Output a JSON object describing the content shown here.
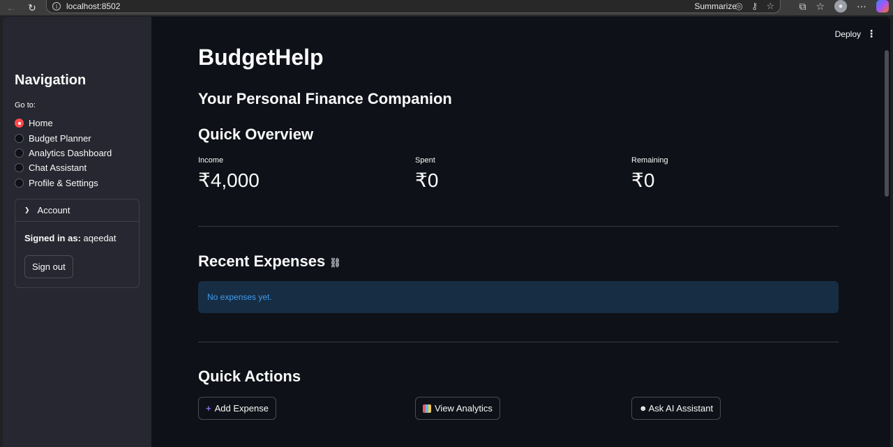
{
  "browser": {
    "url": "localhost:8502",
    "summarize_label": "Summarize"
  },
  "sidebar": {
    "title": "Navigation",
    "goto_label": "Go to:",
    "items": [
      {
        "label": "Home",
        "checked": true
      },
      {
        "label": "Budget Planner",
        "checked": false
      },
      {
        "label": "Analytics Dashboard",
        "checked": false
      },
      {
        "label": "Chat Assistant",
        "checked": false
      },
      {
        "label": "Profile & Settings",
        "checked": false
      }
    ],
    "account": {
      "header": "Account",
      "signed_in_prefix": "Signed in as:",
      "username": "aqeedat",
      "signout_label": "Sign out"
    }
  },
  "header": {
    "deploy_label": "Deploy"
  },
  "main": {
    "title": "BudgetHelp",
    "subtitle": "Your Personal Finance Companion",
    "overview_heading": "Quick Overview",
    "metrics": [
      {
        "label": "Income",
        "value": "₹4,000"
      },
      {
        "label": "Spent",
        "value": "₹0"
      },
      {
        "label": "Remaining",
        "value": "₹0"
      }
    ],
    "recent_heading": "Recent Expenses",
    "no_expenses": "No expenses yet.",
    "actions_heading": "Quick Actions",
    "actions": [
      {
        "label": "Add Expense",
        "icon": "plus-icon"
      },
      {
        "label": "View Analytics",
        "icon": "bar-chart-icon"
      },
      {
        "label": "Ask AI Assistant",
        "icon": "robot-icon"
      }
    ]
  },
  "colors": {
    "primary": "#ff4b4b",
    "background": "#0e1117",
    "sidebar": "#262730",
    "info_bg": "#172d43",
    "info_text": "#3d9df3"
  }
}
